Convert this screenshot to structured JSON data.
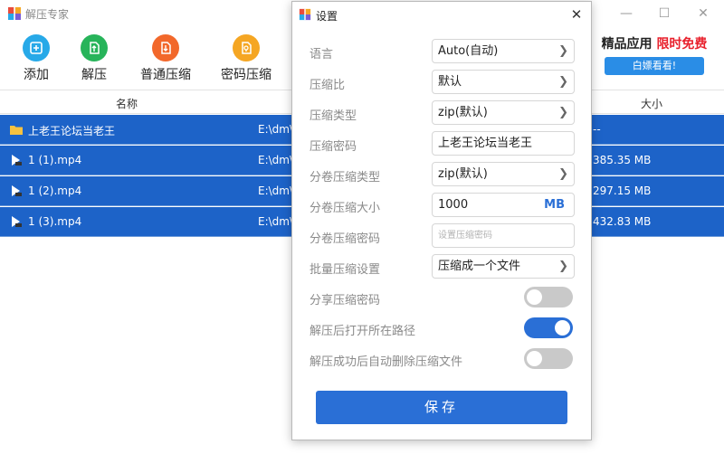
{
  "app": {
    "title": "解压专家",
    "window_controls": {
      "minimize": "—",
      "maximize": "☐",
      "close": "✕"
    },
    "toolbar": [
      {
        "label": "添加",
        "icon": "plus-icon",
        "color": "#27a9e8"
      },
      {
        "label": "解压",
        "icon": "extract-icon",
        "color": "#27b45a"
      },
      {
        "label": "普通压缩",
        "icon": "zip-icon",
        "color": "#f2682b"
      },
      {
        "label": "密码压缩",
        "icon": "lock-zip-icon",
        "color": "#f5a623"
      }
    ],
    "ad": {
      "text_black": "精品应用",
      "text_red": "限时免费",
      "button": "白嫖看看!"
    },
    "columns": {
      "name": "名称",
      "size": "大小"
    },
    "files": [
      {
        "name": "上老王论坛当老王",
        "path": "E:\\dm\\",
        "size": "--",
        "type": "folder"
      },
      {
        "name": "1 (1).mp4",
        "path": "E:\\dm\\",
        "size": "385.35 MB",
        "type": "video"
      },
      {
        "name": "1 (2).mp4",
        "path": "E:\\dm\\",
        "size": "297.15 MB",
        "type": "video"
      },
      {
        "name": "1 (3).mp4",
        "path": "E:\\dm\\",
        "size": "432.83 MB",
        "type": "video"
      }
    ]
  },
  "dialog": {
    "title": "设置",
    "close": "✕",
    "settings": {
      "language": {
        "label": "语言",
        "value": "Auto(自动)"
      },
      "ratio": {
        "label": "压缩比",
        "value": "默认"
      },
      "type": {
        "label": "压缩类型",
        "value": "zip(默认)"
      },
      "password": {
        "label": "压缩密码",
        "value": "上老王论坛当老王"
      },
      "split_type": {
        "label": "分卷压缩类型",
        "value": "zip(默认)"
      },
      "split_size": {
        "label": "分卷压缩大小",
        "value": "1000",
        "unit": "MB"
      },
      "split_password": {
        "label": "分卷压缩密码",
        "placeholder": "设置压缩密码"
      },
      "batch": {
        "label": "批量压缩设置",
        "value": "压缩成一个文件"
      },
      "share_password": {
        "label": "分享压缩密码",
        "on": false
      },
      "open_path": {
        "label": "解压后打开所在路径",
        "on": true
      },
      "auto_delete": {
        "label": "解压成功后自动删除压缩文件",
        "on": false
      }
    },
    "save": "保存"
  },
  "colors": {
    "accent": "#2a6fd6",
    "selection": "#1d63c8",
    "ad_red": "#e8202c"
  }
}
